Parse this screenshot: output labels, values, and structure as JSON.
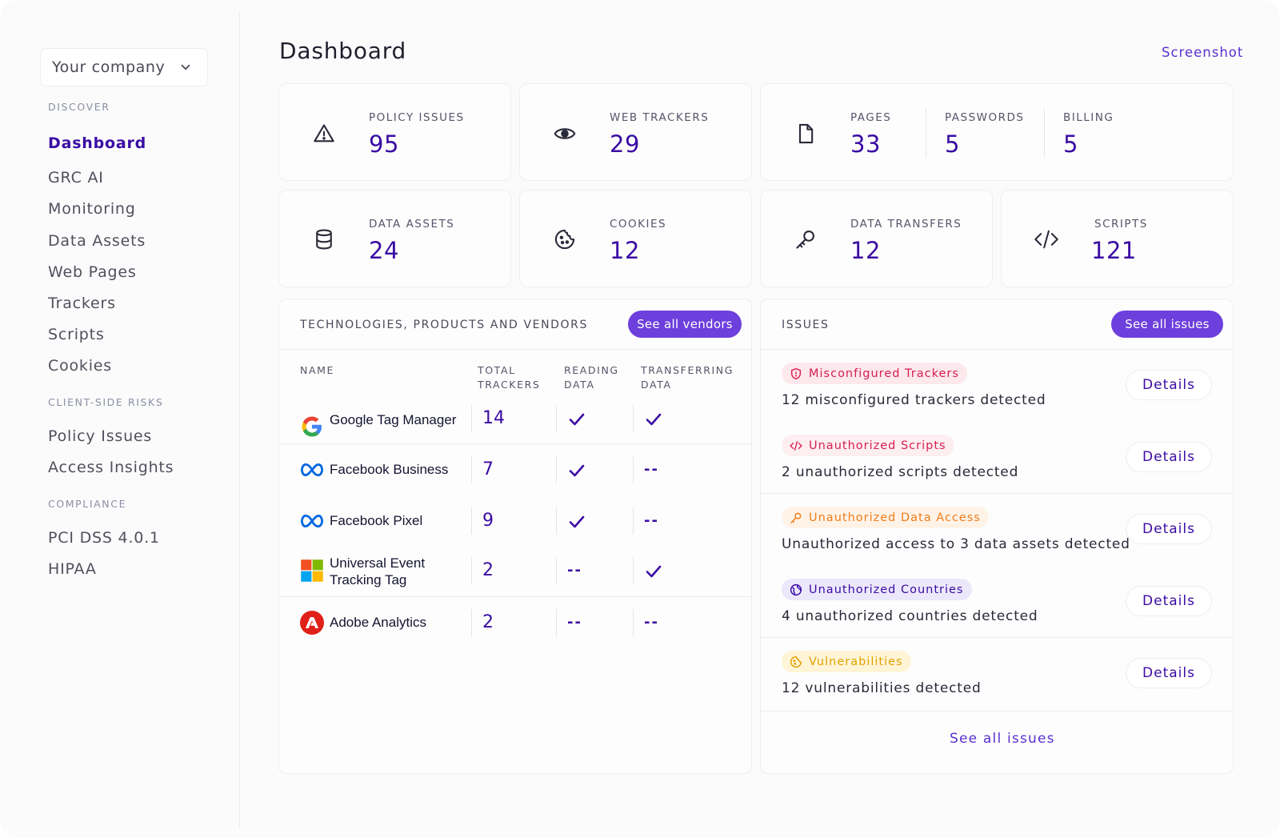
{
  "sidebar": {
    "company": "Your company",
    "sections": [
      {
        "label": "DISCOVER"
      },
      {
        "label": "CLIENT-SIDE RISKS"
      },
      {
        "label": "COMPLIANCE"
      }
    ],
    "items": [
      {
        "label": "Dashboard"
      },
      {
        "label": "GRC AI"
      },
      {
        "label": "Monitoring"
      },
      {
        "label": "Data Assets"
      },
      {
        "label": "Web Pages"
      },
      {
        "label": "Trackers"
      },
      {
        "label": "Scripts"
      },
      {
        "label": "Cookies"
      },
      {
        "label": "Policy Issues"
      },
      {
        "label": "Access Insights"
      },
      {
        "label": "PCI DSS 4.0.1"
      },
      {
        "label": "HIPAA"
      }
    ],
    "active": "Dashboard"
  },
  "header": {
    "title": "Dashboard",
    "screenshot_link": "Screenshot"
  },
  "stats": {
    "policy_issues": {
      "label": "POLICY ISSUES",
      "value": "95",
      "icon": "warning-triangle-icon"
    },
    "web_trackers": {
      "label": "WEB TRACKERS",
      "value": "29",
      "icon": "eye-icon"
    },
    "pages": {
      "label": "PAGES",
      "value": "33",
      "icon": "document-icon"
    },
    "passwords": {
      "label": "PASSWORDS",
      "value": "5"
    },
    "billing": {
      "label": "BILLING",
      "value": "5"
    },
    "data_assets": {
      "label": "DATA ASSETS",
      "value": "24",
      "icon": "database-icon"
    },
    "cookies": {
      "label": "COOKIES",
      "value": "12",
      "icon": "cookie-icon"
    },
    "data_transfers": {
      "label": "DATA TRANSFERS",
      "value": "12",
      "icon": "key-icon"
    },
    "scripts": {
      "label": "SCRIPTS",
      "value": "121",
      "icon": "code-icon"
    }
  },
  "vendors": {
    "title": "TECHNOLOGIES, PRODUCTS AND VENDORS",
    "button": "See all vendors",
    "columns": {
      "name": "NAME",
      "total_1": "TOTAL",
      "total_2": "TRACKERS",
      "reading_1": "READING",
      "reading_2": "DATA",
      "transferring_1": "TRANSFERRING",
      "transferring_2": "DATA"
    },
    "dash": "--",
    "rows": [
      {
        "name": "Google Tag Manager",
        "name_2": "",
        "trackers": "14",
        "reading": true,
        "transferring": true,
        "logo": "google-logo-icon"
      },
      {
        "name": "Facebook Business",
        "name_2": "",
        "trackers": "7",
        "reading": true,
        "transferring": false,
        "logo": "meta-logo-icon"
      },
      {
        "name": "Facebook Pixel",
        "name_2": "",
        "trackers": "9",
        "reading": true,
        "transferring": false,
        "logo": "meta-logo-icon"
      },
      {
        "name": "Universal Event",
        "name_2": "Tracking Tag",
        "trackers": "2",
        "reading": false,
        "transferring": true,
        "logo": "microsoft-logo-icon"
      },
      {
        "name": "Adobe Analytics",
        "name_2": "",
        "trackers": "2",
        "reading": false,
        "transferring": false,
        "logo": "adobe-logo-icon"
      }
    ]
  },
  "issues": {
    "title": "ISSUES",
    "button": "See all issues",
    "details_label": "Details",
    "footer_link": "See all issues",
    "items": [
      {
        "tag": "Misconfigured Trackers",
        "text": "12 misconfigured trackers detected",
        "icon": "shield-icon",
        "color": "#d6204f",
        "bg": "#fde8ed"
      },
      {
        "tag": "Unauthorized Scripts",
        "text": "2 unauthorized scripts detected",
        "icon": "code-icon",
        "color": "#d6204f",
        "bg": "#fdeef1"
      },
      {
        "tag": "Unauthorized Data Access",
        "text": "Unauthorized access to 3 data assets detected",
        "icon": "key-icon",
        "color": "#ef7d1a",
        "bg": "#fff3e8"
      },
      {
        "tag": "Unauthorized Countries",
        "text": "4 unauthorized countries detected",
        "icon": "globe-icon",
        "color": "#3a0ca3",
        "bg": "#ece8fb"
      },
      {
        "tag": "Vulnerabilities",
        "text": "12 vulnerabilities detected",
        "icon": "cookie-icon",
        "color": "#e0a100",
        "bg": "#fff5d6"
      }
    ]
  },
  "colors": {
    "accent": "#3a0ca3",
    "button": "#6d3fdc",
    "link": "#5b2fd0"
  }
}
